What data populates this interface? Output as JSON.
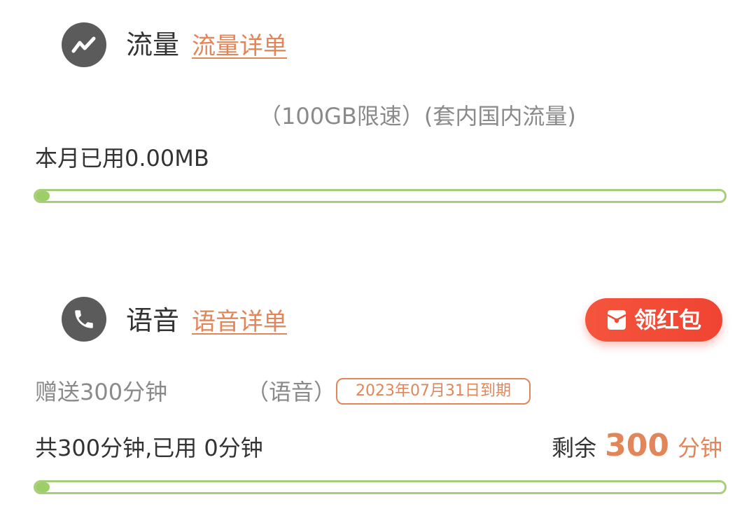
{
  "data_section": {
    "title": "流量",
    "detail_link": "流量详单",
    "package_label": "（100GB限速）(套内国内流量)",
    "used_text": "本月已用0.00MB",
    "used_fraction": 0.01
  },
  "voice_section": {
    "title": "语音",
    "detail_link": "语音详单",
    "red_packet_button": "领红包",
    "gift_text": "赠送300分钟",
    "category": "（语音）",
    "expiry": "2023年07月31日到期",
    "summary": "共300分钟,已用 0分钟",
    "remaining_label": "剩余",
    "remaining_value": "300",
    "remaining_unit": "分钟",
    "used_fraction": 0.01
  },
  "colors": {
    "accent": "#e2865a",
    "progress_green": "#9dce68",
    "button_red": "#f04a35",
    "icon_gray": "#5b5b5b"
  },
  "icons": {
    "data_section": "trend-line-icon",
    "voice_section": "phone-icon",
    "red_packet": "red-envelope-icon"
  }
}
